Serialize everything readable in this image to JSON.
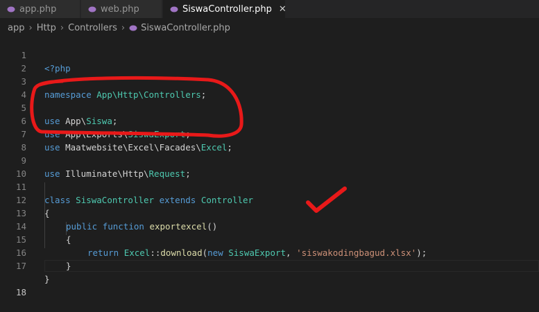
{
  "tabs": [
    {
      "label": "app.php",
      "active": false
    },
    {
      "label": "web.php",
      "active": false
    },
    {
      "label": "SiswaController.php",
      "active": true
    }
  ],
  "tab_close_glyph": "✕",
  "breadcrumb": {
    "items": [
      "app",
      "Http",
      "Controllers",
      "SiswaController.php"
    ],
    "separator": "›"
  },
  "editor": {
    "line_numbers": [
      "1",
      "2",
      "3",
      "4",
      "5",
      "6",
      "7",
      "8",
      "9",
      "10",
      "11",
      "12",
      "13",
      "14",
      "15",
      "16",
      "17",
      "18"
    ],
    "current_line": "18",
    "lines": {
      "l1": {
        "open_tag": "<?php"
      },
      "l3": {
        "kw": "namespace",
        "ns": "App\\Http\\Controllers",
        "semi": ";"
      },
      "l5": {
        "kw": "use",
        "path": "App\\",
        "cls": "Siswa",
        "semi": ";"
      },
      "l6": {
        "kw": "use",
        "path": "App\\Exports\\",
        "cls": "SiswaExport",
        "semi": ";"
      },
      "l7": {
        "kw": "use",
        "path": "Maatwebsite\\Excel\\Facades\\",
        "cls": "Excel",
        "semi": ";"
      },
      "l9": {
        "kw": "use",
        "path": "Illuminate\\Http\\",
        "cls": "Request",
        "semi": ";"
      },
      "l11": {
        "kw_class": "class",
        "cls": "SiswaController",
        "kw_extends": "extends",
        "parent": "Controller"
      },
      "l12": {
        "brace": "{"
      },
      "l13": {
        "kw_public": "public",
        "kw_function": "function",
        "fn": "exportexcel",
        "parens": "()"
      },
      "l14": {
        "brace": "{"
      },
      "l15": {
        "kw_return": "return",
        "cls": "Excel",
        "op": "::",
        "fn": "download",
        "open": "(",
        "kw_new": "new",
        "arg_cls": "SiswaExport",
        "comma": ",",
        "str": "'siswakodingbagud.xlsx'",
        "close": ");"
      },
      "l16": {
        "brace": "}"
      },
      "l17": {
        "brace": "}"
      }
    }
  },
  "icons": {
    "php_file": "php-elephant-icon",
    "close": "close-icon",
    "chevron": "chevron-right-icon"
  },
  "colors": {
    "bg": "#1e1e1e",
    "tabbar": "#252526",
    "keyword": "#569cd6",
    "class": "#4ec9b0",
    "function": "#dcdcaa",
    "string": "#ce9178",
    "annotation": "#e81919"
  }
}
